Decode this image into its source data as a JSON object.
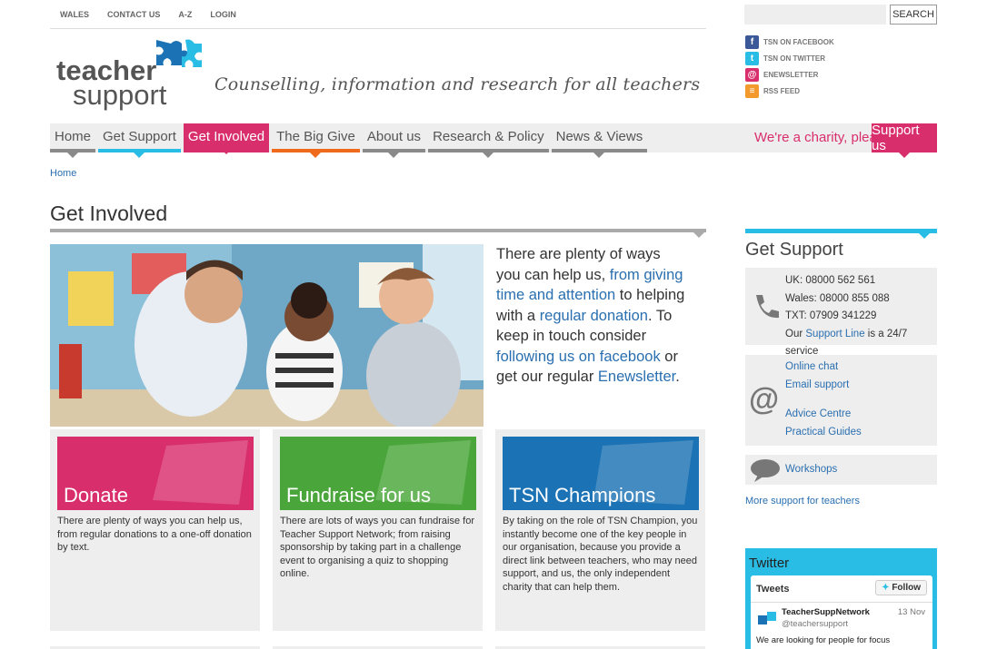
{
  "top_links": [
    "WALES",
    "CONTACT US",
    "A-Z",
    "LOGIN"
  ],
  "search": {
    "placeholder": "",
    "button": "SEARCH"
  },
  "social": [
    {
      "label": "TSN ON FACEBOOK",
      "icon": "facebook-icon",
      "color": "#3b5998",
      "glyph": "f"
    },
    {
      "label": "TSN ON TWITTER",
      "icon": "twitter-icon",
      "color": "#29bde5",
      "glyph": "t"
    },
    {
      "label": "ENEWSLETTER",
      "icon": "newsletter-icon",
      "color": "#d92e6c",
      "glyph": "@"
    },
    {
      "label": "RSS FEED",
      "icon": "rss-icon",
      "color": "#f39a2f",
      "glyph": "≡"
    }
  ],
  "logo": {
    "line1": "teacher",
    "line2": "support"
  },
  "tagline": "Counselling, information and research for all teachers",
  "nav": [
    {
      "label": "Home",
      "accent": "#8a8a8a",
      "active": false
    },
    {
      "label": "Get Support",
      "accent": "#29bde5",
      "active": false
    },
    {
      "label": "Get Involved",
      "accent": "#d92e6c",
      "active": true
    },
    {
      "label": "The Big Give",
      "accent": "#f06a1e",
      "active": false
    },
    {
      "label": "About us",
      "accent": "#8a8a8a",
      "active": false
    },
    {
      "label": "Research & Policy",
      "accent": "#8a8a8a",
      "active": false
    },
    {
      "label": "News & Views",
      "accent": "#8a8a8a",
      "active": false
    }
  ],
  "charity_text": "We're a charity, please",
  "support_button": "Support us",
  "breadcrumb": "Home",
  "page_title": "Get Involved",
  "intro": {
    "p1": "There are plenty of ways you can help us, ",
    "l1": "from giving time and attention",
    "p2": " to helping with a ",
    "l2": "regular donation",
    "p3": ". To keep in touch consider ",
    "l3": "following us on facebook",
    "p4": " or get our regular ",
    "l4": "Enewsletter",
    "p5": "."
  },
  "cards": [
    {
      "title": "Donate",
      "color": "#d92e6c",
      "desc": "There are plenty of ways you can help us, from regular donations to a one-off donation by text."
    },
    {
      "title": "Fundraise for us",
      "color": "#4aa63a",
      "desc": "There are lots of ways you can fundraise for Teacher Support Network; from raising sponsorship by taking part in a challenge event to organising a quiz to shopping online."
    },
    {
      "title": "TSN Champions",
      "color": "#1b72b4",
      "desc": "By taking on the role of TSN Champion, you instantly become one of the key people in our organisation, because  you provide a direct link between teachers, who may need support, and us, the only independent charity that can help them."
    }
  ],
  "sidebar": {
    "title": "Get Support",
    "phone_lines": [
      "UK: 08000 562 561",
      "Wales: 08000 855 088",
      "TXT: 07909 341229"
    ],
    "support_line_pre": "Our ",
    "support_line_link": "Support Line",
    "support_line_post": " is a 24/7 service",
    "online_links": [
      "Online chat",
      "Email support"
    ],
    "centre_links": [
      "Advice Centre",
      "Practical Guides"
    ],
    "workshops": "Workshops",
    "more": "More support for teachers"
  },
  "twitter": {
    "title": "Twitter",
    "tweets_label": "Tweets",
    "follow": "Follow",
    "name": "TeacherSuppNetwork",
    "handle": "@teachersupport",
    "date": "13 Nov",
    "message": "We are looking for people for focus"
  }
}
